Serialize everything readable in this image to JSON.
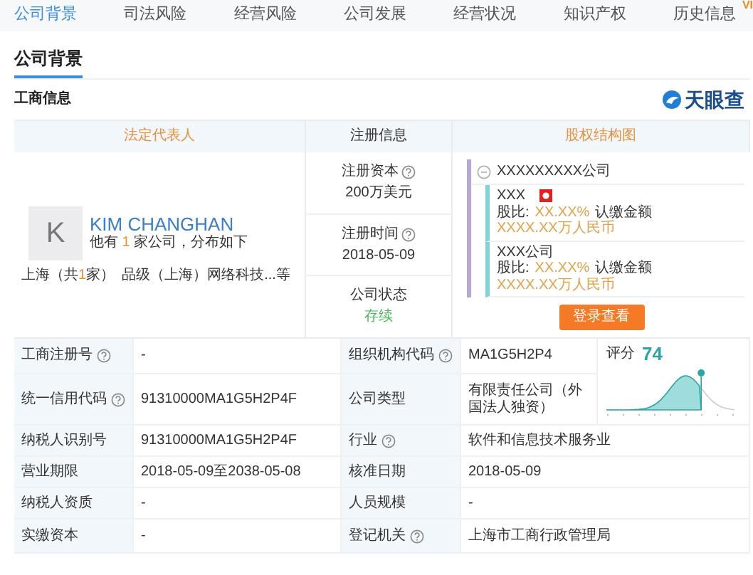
{
  "nav_tabs": [
    {
      "label": "公司背景",
      "selected": true
    },
    {
      "label": "司法风险",
      "selected": false
    },
    {
      "label": "经营风险",
      "selected": false
    },
    {
      "label": "公司发展",
      "selected": false
    },
    {
      "label": "经营状况",
      "selected": false
    },
    {
      "label": "知识产权",
      "selected": false
    },
    {
      "label": "历史信息",
      "selected": false
    }
  ],
  "vip_badge": "VI",
  "section_title": "公司背景",
  "subsection_title": "工商信息",
  "brand_logo": "天眼查",
  "legal_rep": {
    "header": "法定代表人",
    "avatar_letter": "K",
    "name": "KIM CHANGHAN",
    "summary_before": "他有",
    "company_count": "1",
    "summary_after": "家公司，分布如下",
    "region_before": "上海（共",
    "region_count": "1",
    "region_after": "家）",
    "companies": "品级（上海）网络科技...等"
  },
  "reg_info": {
    "header": "注册信息",
    "items": [
      {
        "label": "注册资本",
        "help": true,
        "value": "200万美元",
        "kind": "plain"
      },
      {
        "label": "注册时间",
        "help": true,
        "value": "2018-05-09",
        "kind": "plain"
      },
      {
        "label": "公司状态",
        "help": false,
        "value": "存续",
        "kind": "status"
      }
    ]
  },
  "equity": {
    "header": "股权结构图",
    "root": "XXXXXXXXX公司",
    "holders": [
      {
        "name": "XXX",
        "flagged": true,
        "share_label": "股比:",
        "share": "XX.XX%",
        "amount_label": "认缴金额",
        "amount": "XXXX.XX万人民币"
      },
      {
        "name": "XXX公司",
        "flagged": false,
        "share_label": "股比:",
        "share": "XX.XX%",
        "amount_label": "认缴金额",
        "amount": "XXXX.XX万人民币"
      }
    ],
    "button": "登录查看"
  },
  "details": [
    {
      "label": "工商注册号",
      "help": true,
      "value": "-",
      "label2": "组织机构代码",
      "help2": true,
      "value2": "MA1G5H2P4"
    },
    {
      "label": "统一信用代码",
      "help": true,
      "value": "91310000MA1G5H2P4F",
      "label2": "公司类型",
      "help2": false,
      "value2": "有限责任公司（外国法人独资）"
    },
    {
      "label": "纳税人识别号",
      "help": false,
      "value": "91310000MA1G5H2P4F",
      "label2": "行业",
      "help2": true,
      "value2": "软件和信息技术服务业"
    },
    {
      "label": "营业期限",
      "help": false,
      "value": "2018-05-09至2038-05-08",
      "label2": "核准日期",
      "help2": false,
      "value2": "2018-05-09"
    },
    {
      "label": "纳税人资质",
      "help": false,
      "value": "-",
      "label2": "人员规模",
      "help2": false,
      "value2": "-"
    },
    {
      "label": "实缴资本",
      "help": false,
      "value": "-",
      "label2": "登记机关",
      "help2": true,
      "value2": "上海市工商行政管理局"
    }
  ],
  "score": {
    "label": "评分",
    "value": "74",
    "level": 0.74
  }
}
